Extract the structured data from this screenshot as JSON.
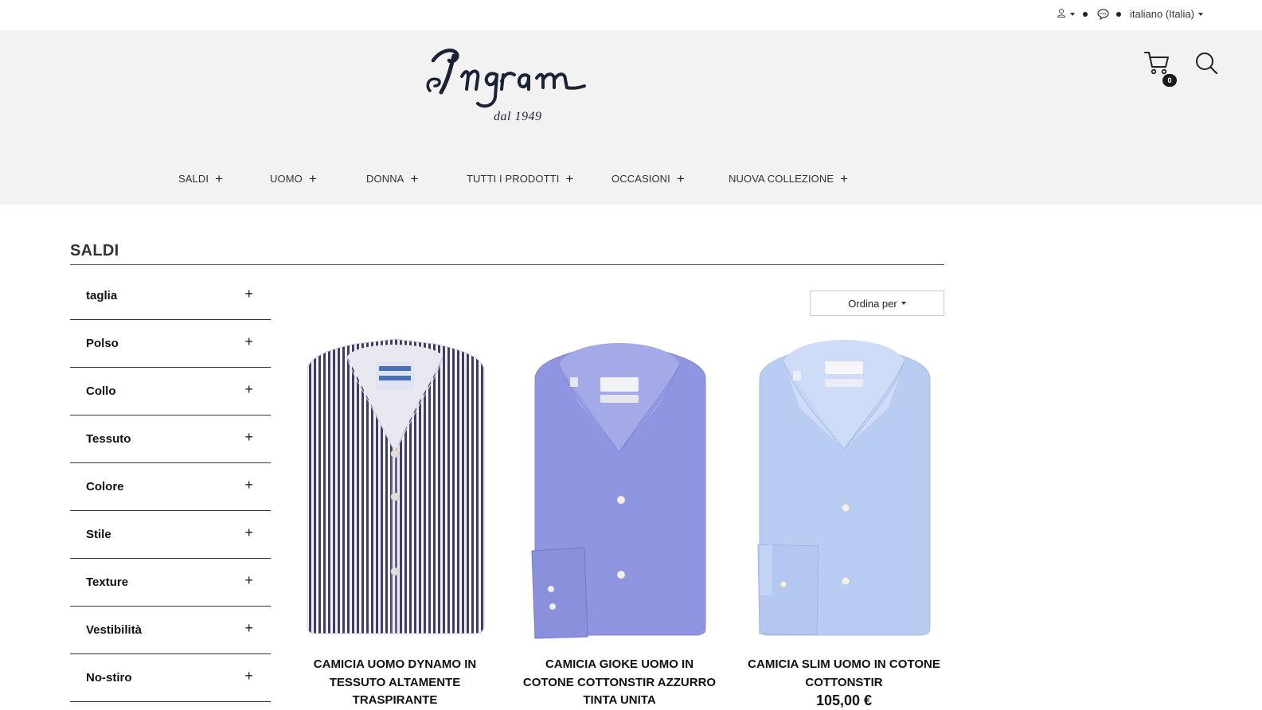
{
  "topbar": {
    "user_icon": "user-icon",
    "chat_icon": "chat-bubble-icon",
    "language": "italiano (Italia)"
  },
  "header": {
    "logo_text": "Ingram",
    "logo_subtitle": "dal 1949",
    "cart_count": "0",
    "cart_icon": "cart-icon",
    "search_icon": "search-icon"
  },
  "nav": {
    "items": [
      {
        "label": "SALDI"
      },
      {
        "label": "UOMO"
      },
      {
        "label": "DONNA"
      },
      {
        "label": "TUTTI I PRODOTTI"
      },
      {
        "label": "OCCASIONI"
      },
      {
        "label": "NUOVA COLLEZIONE"
      }
    ],
    "expand_symbol": "+"
  },
  "page": {
    "title": "SALDI",
    "sort_label": "Ordina per"
  },
  "filters": [
    {
      "label": "taglia"
    },
    {
      "label": "Polso"
    },
    {
      "label": "Collo"
    },
    {
      "label": "Tessuto"
    },
    {
      "label": "Colore"
    },
    {
      "label": "Stile"
    },
    {
      "label": "Texture"
    },
    {
      "label": "Vestibilità"
    },
    {
      "label": "No-stiro"
    }
  ],
  "products": [
    {
      "name": "CAMICIA UOMO DYNAMO IN TESSUTO ALTAMENTE TRASPIRANTE",
      "price": "",
      "color": "#3f3d60"
    },
    {
      "name": "CAMICIA GIOKE UOMO IN COTONE COTTONSTIR AZZURRO TINTA UNITA",
      "price": "",
      "color": "#8f95e0"
    },
    {
      "name": "CAMICIA SLIM UOMO IN COTONE COTTONSTIR",
      "price": "105,00 €",
      "color": "#b9ccf2"
    }
  ]
}
